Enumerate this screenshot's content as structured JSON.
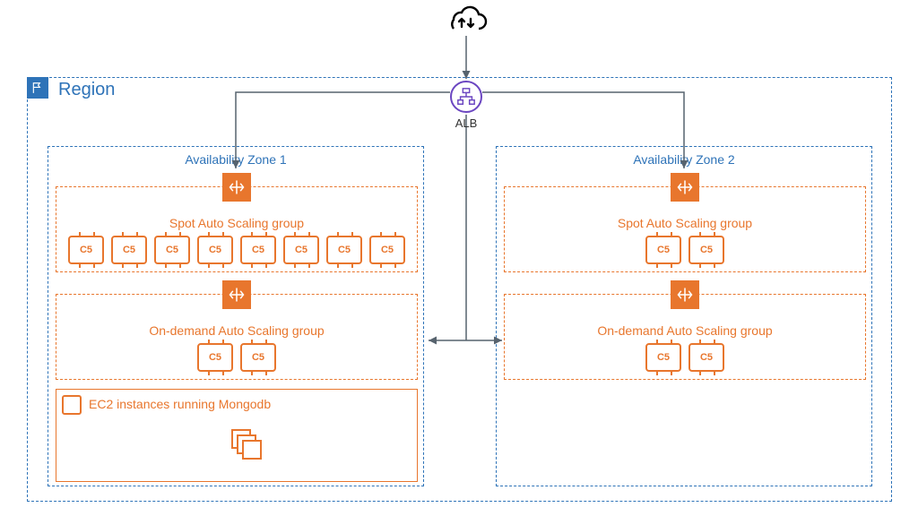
{
  "region": {
    "title": "Region"
  },
  "alb": {
    "label": "ALB"
  },
  "az1": {
    "title": "Availability Zone 1",
    "spot": {
      "title": "Spot Auto Scaling group",
      "instance_label": "C5",
      "count": 8
    },
    "ondemand": {
      "title": "On-demand Auto Scaling group",
      "instance_label": "C5",
      "count": 2
    },
    "mongo": {
      "title": "EC2 instances running Mongodb"
    }
  },
  "az2": {
    "title": "Availability Zone 2",
    "spot": {
      "title": "Spot Auto Scaling group",
      "instance_label": "C5",
      "count": 2
    },
    "ondemand": {
      "title": "On-demand Auto Scaling group",
      "instance_label": "C5",
      "count": 2
    }
  },
  "colors": {
    "azure": "#2E73B8",
    "orange": "#E8762D",
    "purple": "#6B46C1",
    "arrow": "#57636E"
  }
}
